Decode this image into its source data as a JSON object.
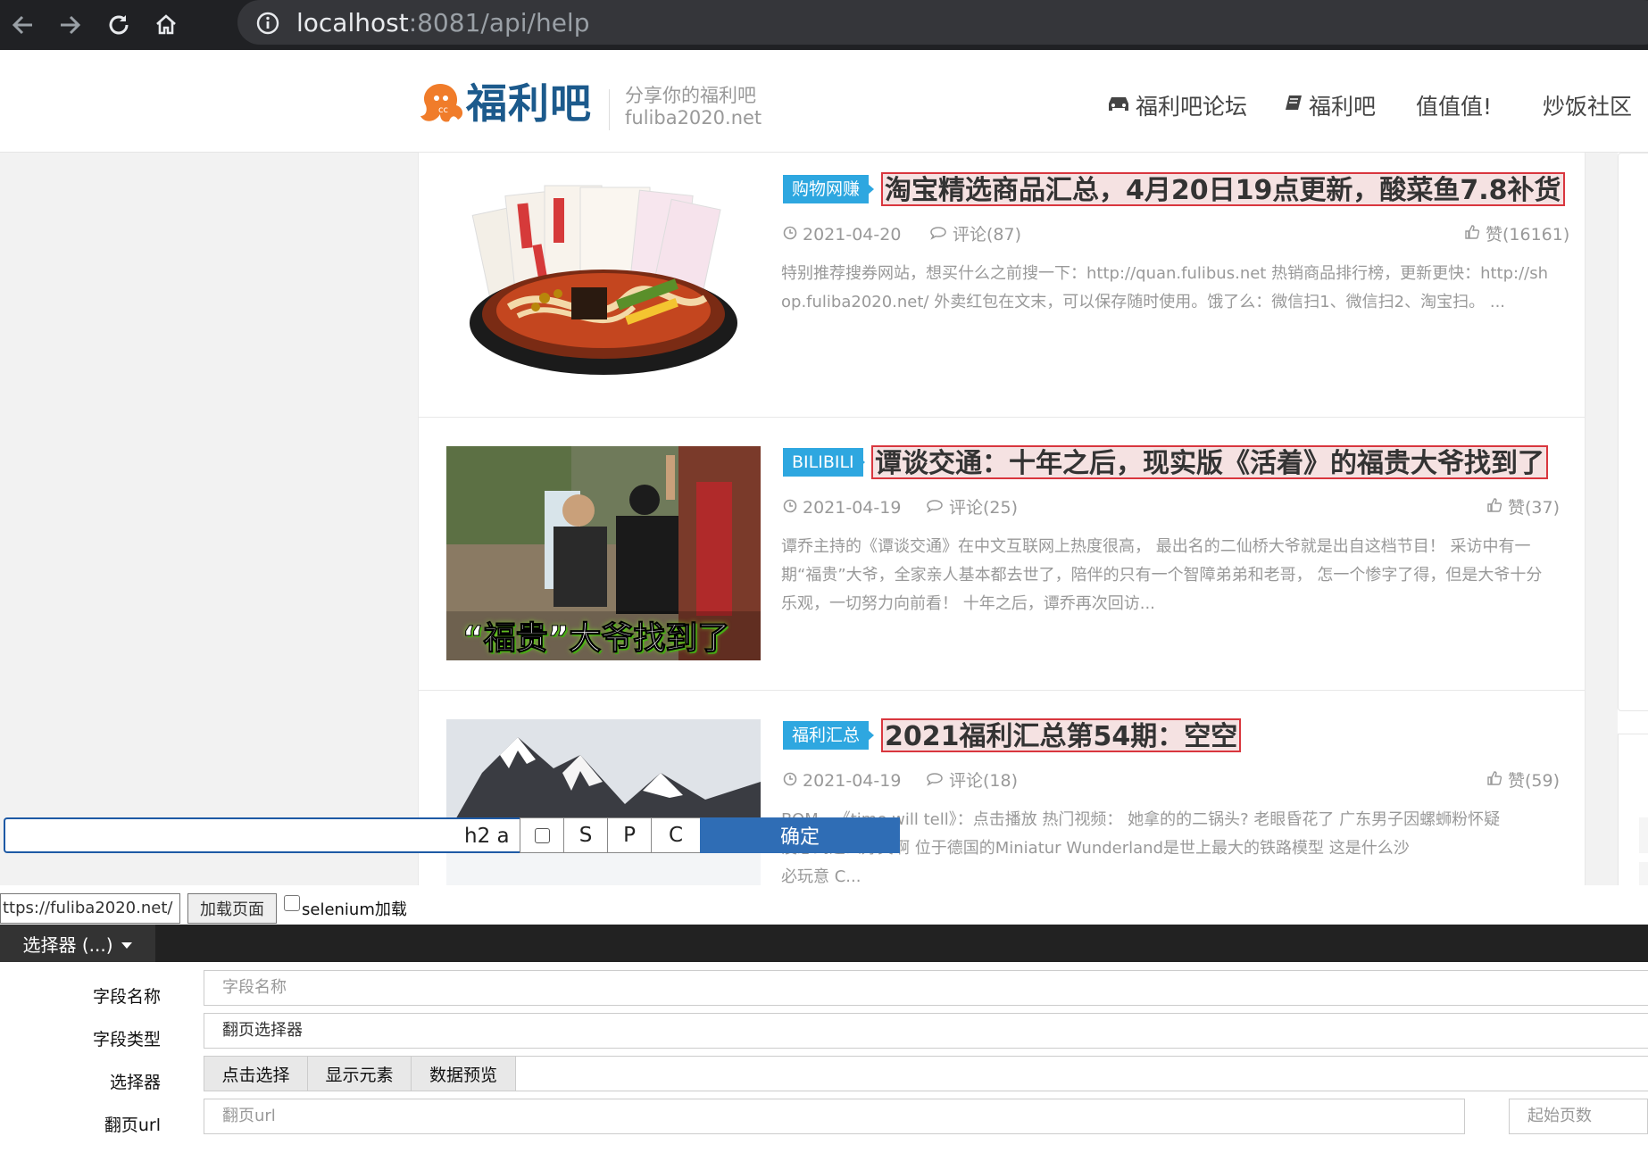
{
  "browser": {
    "url_host": "localhost",
    "url_rest": ":8081/api/help"
  },
  "site": {
    "logo_text": "福利吧",
    "slogan_line1": "分享你的福利吧",
    "slogan_line2": "fuliba2020.net",
    "nav": [
      "福利吧论坛",
      "福利吧",
      "值值值!",
      "炒饭社区"
    ]
  },
  "articles": [
    {
      "category": "购物网赚",
      "title": "淘宝精选商品汇总，4月20日19点更新，酸菜鱼7.8补货",
      "date": "2021-04-20",
      "comments": "评论(87)",
      "likes": "赞(16161)",
      "excerpt": "特别推荐搜券网站，想买什么之前搜一下：http://quan.fulibus.net 热销商品排行榜，更新更快：http://shop.fuliba2020.net/ 外卖红包在文末，可以保存随时使用。饿了么：微信扫1、微信扫2、淘宝扫。 ..."
    },
    {
      "category": "BILIBILI",
      "title": "谭谈交通：十年之后，现实版《活着》的福贵大爷找到了",
      "date": "2021-04-19",
      "comments": "评论(25)",
      "likes": "赞(37)",
      "excerpt": "谭乔主持的《谭谈交通》在中文互联网上热度很高， 最出名的二仙桥大爷就是出自这档节目！ 采访中有一期“福贵”大爷，全家亲人基本都去世了，陪伴的只有一个智障弟弟和老哥， 怎一个惨字了得，但是大爷十分乐观，一切努力向前看！ 十年之后，谭乔再次回访...",
      "thumb_caption": "“福贵”大爷找到了"
    },
    {
      "category": "福利汇总",
      "title": "2021福利汇总第54期：空空",
      "date": "2021-04-19",
      "comments": "评论(18)",
      "likes": "赞(59)",
      "excerpt_line1": "BOM—《time will tell》：点击播放 热门视频： 她拿的的二锅头? 老眼昏花了 广东男子因螺蛳粉怀疑",
      "excerpt_line2": "没想到这么好笑啊 位于德国的Miniatur Wunderland是世上最大的铁路模型 这是什么沙",
      "excerpt_line3": "必玩意 C..."
    }
  ],
  "toolbar": {
    "selector_value": "h2 a",
    "btn_s": "S",
    "btn_p": "P",
    "btn_c": "C",
    "confirm": "确定"
  },
  "panel": {
    "url_value": "ttps://fuliba2020.net/",
    "load_button": "加载页面",
    "selenium_label": "selenium加载",
    "selector_tab": "选择器 (...)",
    "field_name_label": "字段名称",
    "field_name_placeholder": "字段名称",
    "field_type_label": "字段类型",
    "field_type_value": "翻页选择器",
    "selector_label": "选择器",
    "selector_buttons": [
      "点击选择",
      "显示元素",
      "数据预览"
    ],
    "page_url_label": "翻页url",
    "page_url_placeholder": "翻页url",
    "start_page_placeholder": "起始页数"
  },
  "colors": {
    "brand_blue": "#1c5a8c",
    "category_blue": "#2ea7e0",
    "highlight_red": "#d9363e",
    "confirm_blue": "#2f6db5"
  }
}
